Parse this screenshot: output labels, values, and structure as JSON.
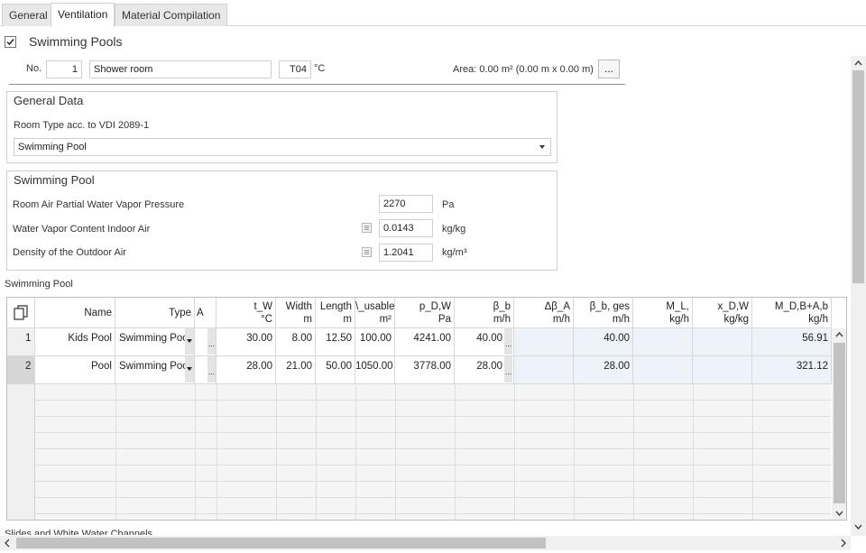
{
  "tabs": [
    "General",
    "Ventilation",
    "Material Compilation"
  ],
  "section_title": "Swimming Pools",
  "room": {
    "no_label": "No.",
    "no_value": "1",
    "name": "Shower room",
    "temp_code": "T04",
    "temp_unit": "°C",
    "area_text": "Area: 0.00  m² (0.00 m x 0.00 m)",
    "more_button": "..."
  },
  "general_data": {
    "title": "General Data",
    "room_type_label": "Room Type acc. to VDI 2089-1",
    "room_type_value": "Swimming Pool"
  },
  "swimming_pool": {
    "title": "Swimming Pool",
    "rows": [
      {
        "label": "Room Air Partial Water Vapor Pressure",
        "value": "2270",
        "unit": "Pa"
      },
      {
        "label": "Water Vapor Content Indoor Air",
        "value": "0.0143",
        "unit": "kg/kg"
      },
      {
        "label": "Density of the Outdoor Air",
        "value": "1.2041",
        "unit": "kg/m³"
      }
    ]
  },
  "table_caption": "Swimming Pool",
  "table": {
    "headers": [
      {
        "l1": "Name",
        "l2": ""
      },
      {
        "l1": "Type",
        "l2": ""
      },
      {
        "l1": "A",
        "l2": ""
      },
      {
        "l1": "t_W",
        "l2": "°C"
      },
      {
        "l1": "Width",
        "l2": "m"
      },
      {
        "l1": "Length",
        "l2": "m"
      },
      {
        "l1": "\\_usable",
        "l2": "m²"
      },
      {
        "l1": "p_D,W",
        "l2": "Pa"
      },
      {
        "l1": "β_b",
        "l2": "m/h"
      },
      {
        "l1": "Δβ_A",
        "l2": "m/h"
      },
      {
        "l1": "β_b, ges",
        "l2": "m/h"
      },
      {
        "l1": "M_L,",
        "l2": "kg/h"
      },
      {
        "l1": "x_D,W",
        "l2": "kg/kg"
      },
      {
        "l1": "M_D,B+A,b",
        "l2": "kg/h"
      }
    ],
    "rows": [
      {
        "num": "1",
        "cells": [
          "Kids Pool",
          "Swimming Pool",
          "",
          "30.00",
          "8.00",
          "12.50",
          "100.00",
          "4241.00",
          "40.00",
          "",
          "40.00",
          "",
          "",
          "56.91"
        ]
      },
      {
        "num": "2",
        "cells": [
          "Pool",
          "Swimming Pool",
          "",
          "28.00",
          "21.00",
          "50.00",
          "1050.00",
          "3778.00",
          "28.00",
          "",
          "28.00",
          "",
          "",
          "321.12"
        ]
      }
    ],
    "ellipsis": "..."
  },
  "next_section": "Slides and White Water Channels",
  "icons": [
    "checkbox-checked-icon",
    "copy-icon",
    "dropdown-arrow-icon",
    "table-icon",
    "scroll-up-icon",
    "scroll-down-icon",
    "scroll-left-icon",
    "scroll-right-icon"
  ]
}
